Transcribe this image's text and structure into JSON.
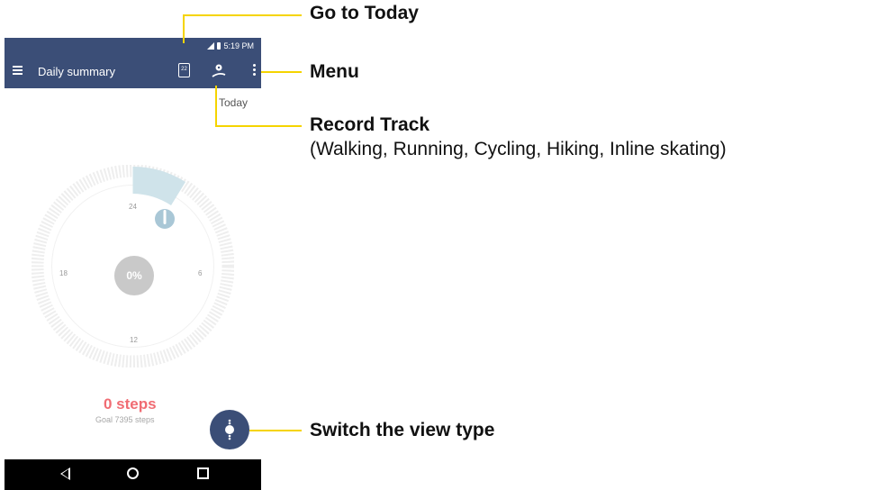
{
  "status_bar": {
    "time": "5:19 PM"
  },
  "app_bar": {
    "title": "Daily summary",
    "calendar_day": "22"
  },
  "date_label": "Today",
  "clock": {
    "ticks": {
      "top": "24",
      "right": "6",
      "bottom": "12",
      "left": "18"
    },
    "progress_percent": "0%"
  },
  "summary": {
    "steps": "0 steps",
    "goal": "Goal 7395 steps"
  },
  "callouts": {
    "go_to_today": "Go to Today",
    "menu": "Menu",
    "record_track": "Record Track",
    "record_track_sub": "(Walking, Running, Cycling, Hiking, Inline skating)",
    "switch_view": "Switch the view type"
  },
  "colors": {
    "app_bar": "#3b4e77",
    "steps": "#f06c73",
    "callout_line": "#f5d400",
    "goal_arc": "#cfe3ea"
  }
}
